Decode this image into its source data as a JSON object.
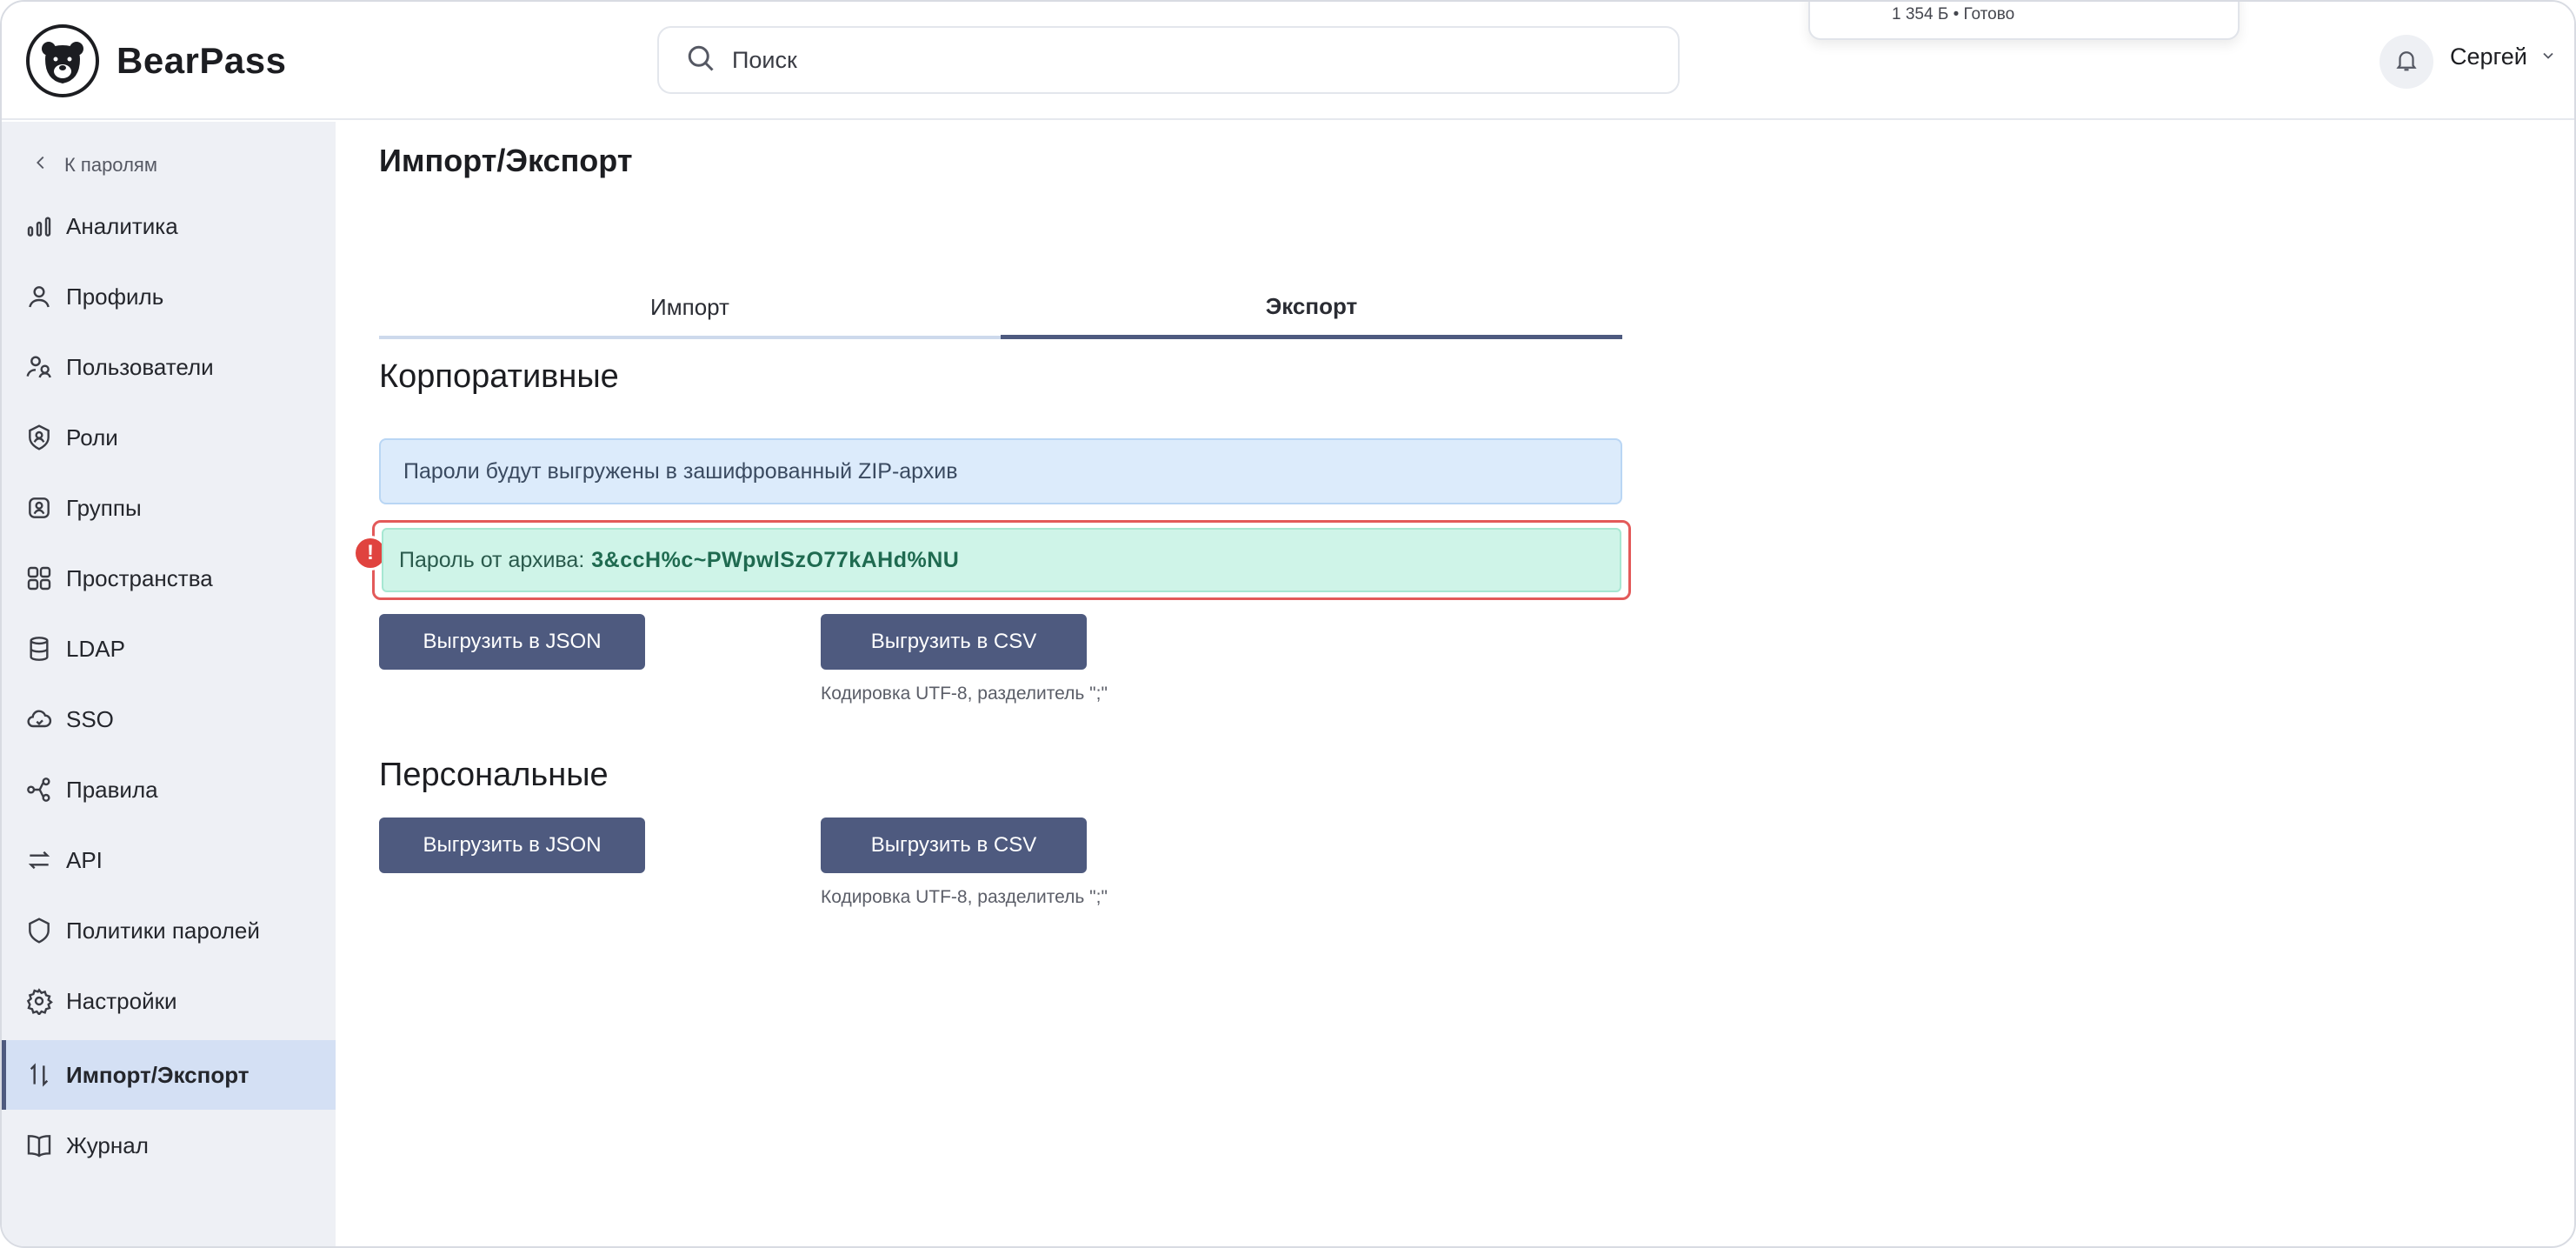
{
  "app": {
    "name": "BearPass"
  },
  "search": {
    "placeholder": "Поиск"
  },
  "download": {
    "status": "1 354 Б • Готово"
  },
  "user": {
    "name": "Сергей"
  },
  "sidebar": {
    "back_label": "К паролям",
    "items": [
      {
        "label": "Аналитика",
        "icon": "analytics-icon"
      },
      {
        "label": "Профиль",
        "icon": "user-icon"
      },
      {
        "label": "Пользователи",
        "icon": "users-icon"
      },
      {
        "label": "Роли",
        "icon": "roles-icon"
      },
      {
        "label": "Группы",
        "icon": "groups-icon"
      },
      {
        "label": "Пространства",
        "icon": "spaces-icon"
      },
      {
        "label": "LDAP",
        "icon": "database-icon"
      },
      {
        "label": "SSO",
        "icon": "cloud-icon"
      },
      {
        "label": "Правила",
        "icon": "rules-icon"
      },
      {
        "label": "API",
        "icon": "arrows-icon"
      },
      {
        "label": "Политики паролей",
        "icon": "shield-icon"
      },
      {
        "label": "Настройки",
        "icon": "gear-icon"
      },
      {
        "label": "Импорт/Экспорт",
        "icon": "import-export-icon",
        "active": true
      },
      {
        "label": "Журнал",
        "icon": "book-icon"
      }
    ]
  },
  "main": {
    "title": "Импорт/Экспорт",
    "tabs": [
      {
        "label": "Импорт"
      },
      {
        "label": "Экспорт",
        "active": true
      }
    ],
    "corporate": {
      "title": "Корпоративные",
      "info": "Пароли будут выгружены в зашифрованный ZIP-архив",
      "password_label": "Пароль от архива:",
      "password_value": "3&ccH%c~PWpwlSzO77kAHd%NU",
      "json_button": "Выгрузить в JSON",
      "csv_button": "Выгрузить в CSV",
      "csv_hint": "Кодировка UTF-8, разделитель \";\""
    },
    "personal": {
      "title": "Персональные",
      "json_button": "Выгрузить в JSON",
      "csv_button": "Выгрузить в CSV",
      "csv_hint": "Кодировка UTF-8, разделитель \";\""
    }
  },
  "colors": {
    "accent": "#4e5a7f",
    "sidebar_bg": "#eef0f5",
    "active_bg": "#d4e0f4",
    "info_bg": "#dcebfb",
    "success_bg": "#cff4e8",
    "alert": "#e0433f"
  }
}
